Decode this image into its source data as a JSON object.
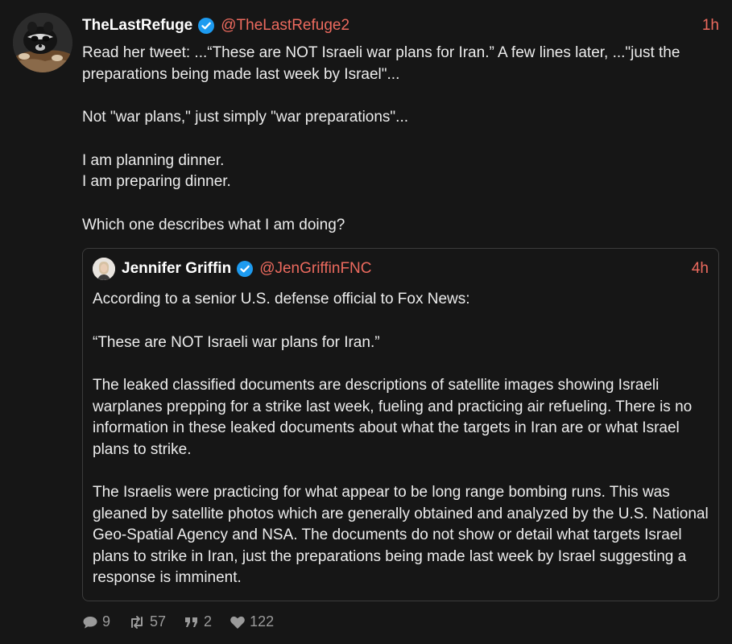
{
  "post": {
    "author": {
      "display_name": "TheLastRefuge",
      "handle": "@TheLastRefuge2",
      "verified": true,
      "avatar_icon": "raccoon-avatar-icon"
    },
    "time": "1h",
    "paragraphs": [
      [
        "Read her tweet: ...“These are NOT Israeli war plans for Iran.”  A few lines later, ...\"just the preparations being made last week by Israel\"..."
      ],
      [
        "Not \"war plans,\" just simply \"war preparations\"..."
      ],
      [
        "I am planning dinner.",
        "I am preparing dinner."
      ],
      [
        "Which one describes what I am doing?"
      ]
    ],
    "quote": {
      "author": {
        "display_name": "Jennifer Griffin",
        "handle": "@JenGriffinFNC",
        "verified": true,
        "avatar_icon": "person-avatar-icon"
      },
      "time": "4h",
      "paragraphs": [
        "According to a senior U.S. defense official to Fox News:",
        "“These are NOT Israeli war plans for Iran.”",
        "The leaked classified documents are descriptions of satellite images showing Israeli warplanes prepping for a strike last week, fueling and practicing air refueling. There is no information in these leaked documents about what the targets in Iran are or what Israel plans to strike.",
        "The Israelis were practicing for what appear to be long range bombing runs. This was gleaned by satellite photos which are generally obtained and analyzed by the U.S. National Geo-Spatial Agency and NSA. The documents do not show or detail what targets Israel plans to strike in Iran, just the preparations being made last week by Israel suggesting a response is imminent."
      ]
    },
    "actions": {
      "replies": "9",
      "reposts": "57",
      "quotes": "2",
      "likes": "122"
    }
  },
  "colors": {
    "background": "#161616",
    "text": "#ececec",
    "accent": "#ec6a5e",
    "verified": "#1d9bf0",
    "muted": "#9a9a9a",
    "border": "#3c3c3c"
  }
}
